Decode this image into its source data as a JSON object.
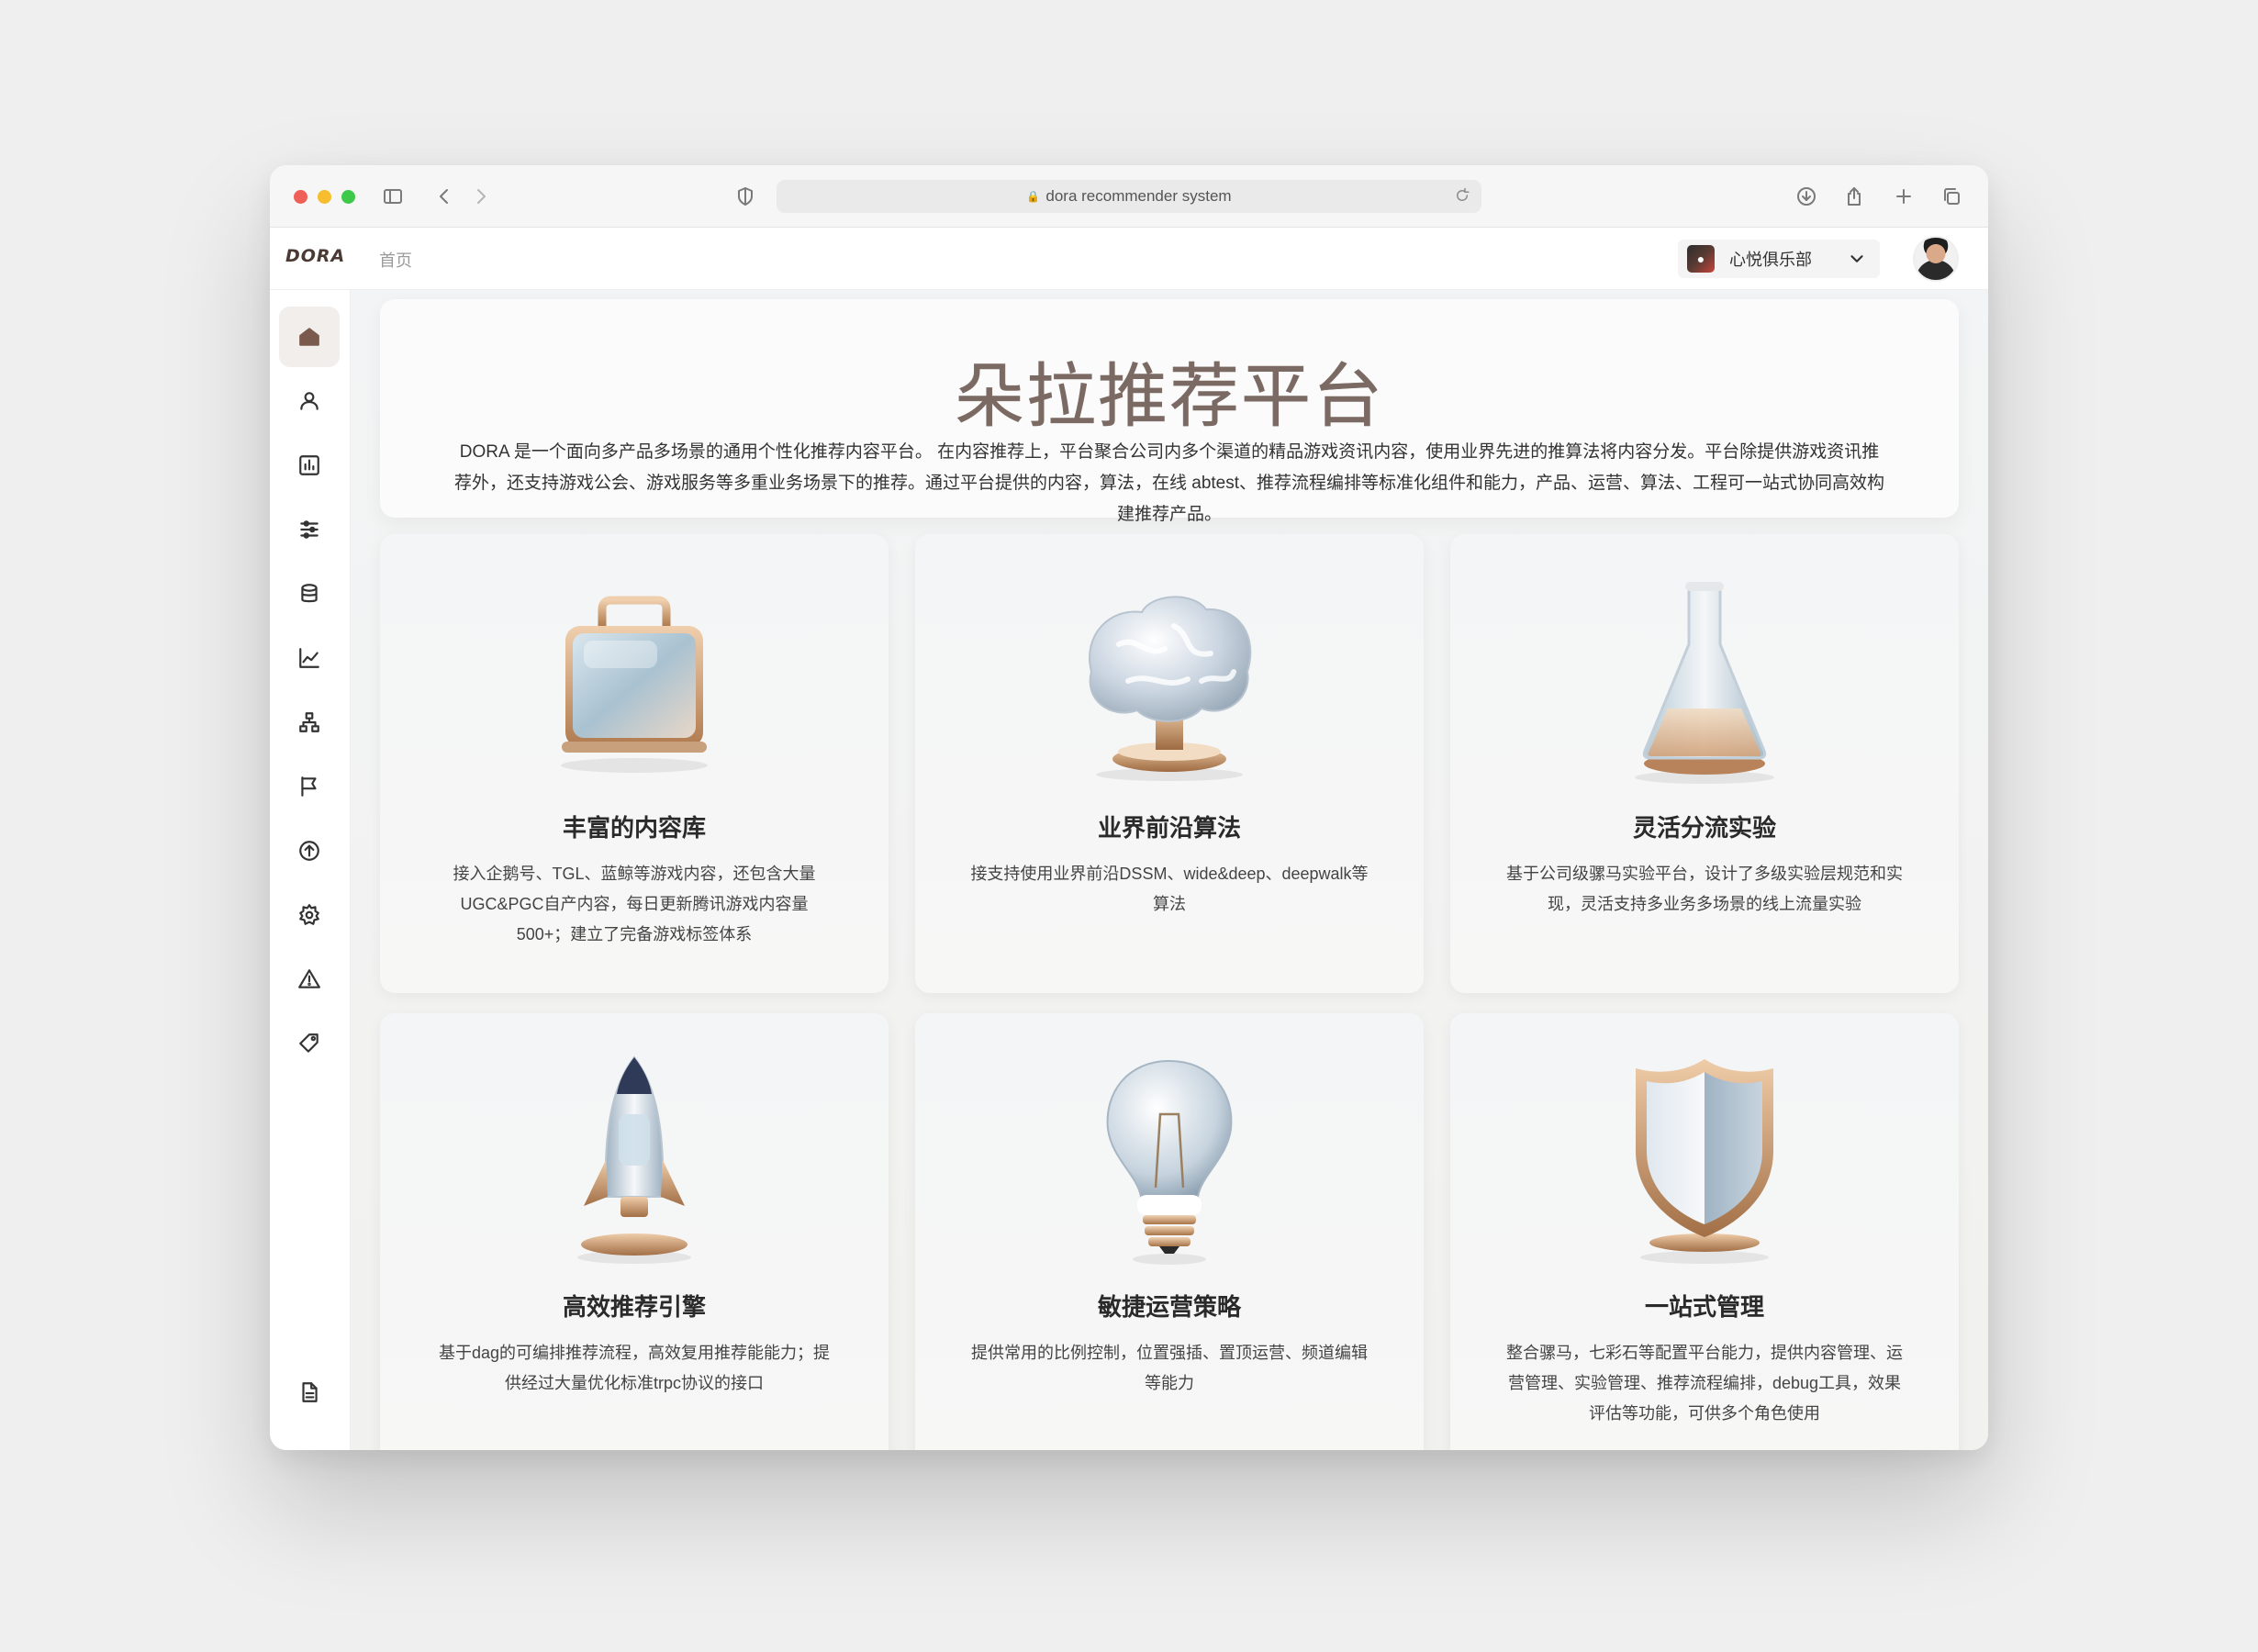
{
  "browser": {
    "url": "dora recommender system"
  },
  "header": {
    "logo": "DORA",
    "breadcrumb": "首页",
    "club": "心悦俱乐部"
  },
  "hero": {
    "title": "朵拉推荐平台",
    "description": "DORA 是一个面向多产品多场景的通用个性化推荐内容平台。 在内容推荐上，平台聚合公司内多个渠道的精品游戏资讯内容，使用业界先进的推算法将内容分发。平台除提供游戏资讯推荐外，还支持游戏公会、游戏服务等多重业务场景下的推荐。通过平台提供的内容，算法，在线 abtest、推荐流程编排等标准化组件和能力，产品、运营、算法、工程可一站式协同高效构建推荐产品。"
  },
  "sidebar": {
    "items": [
      "home-icon",
      "user-icon",
      "bar-chart-icon",
      "sliders-icon",
      "database-icon",
      "line-chart-icon",
      "sitemap-icon",
      "flag-icon",
      "upload-icon",
      "gear-icon",
      "warning-icon",
      "tag-icon",
      "document-icon"
    ]
  },
  "cards": [
    {
      "title": "丰富的内容库",
      "desc": "接入企鹅号、TGL、蓝鲸等游戏内容，还包含大量UGC&PGC自产内容，每日更新腾讯游戏内容量500+；建立了完备游戏标签体系",
      "icon": "briefcase-icon"
    },
    {
      "title": "业界前沿算法",
      "desc": "接支持使用业界前沿DSSM、wide&deep、deepwalk等算法",
      "icon": "brain-icon"
    },
    {
      "title": "灵活分流实验",
      "desc": "基于公司级骡马实验平台，设计了多级实验层规范和实现，灵活支持多业务多场景的线上流量实验",
      "icon": "flask-icon"
    },
    {
      "title": "高效推荐引擎",
      "desc": "基于dag的可编排推荐流程，高效复用推荐能能力；提供经过大量优化标准trpc协议的接口",
      "icon": "rocket-icon"
    },
    {
      "title": "敏捷运营策略",
      "desc": "提供常用的比例控制，位置强插、置顶运营、频道编辑等能力",
      "icon": "lightbulb-icon"
    },
    {
      "title": "一站式管理",
      "desc": "整合骡马，七彩石等配置平台能力，提供内容管理、运营管理、实验管理、推荐流程编排，debug工具，效果评估等功能，可供多个角色使用",
      "icon": "shield-icon"
    }
  ],
  "colors": {
    "accent": "#7b6a63",
    "sidebar_active_bg": "#f1eeec"
  }
}
